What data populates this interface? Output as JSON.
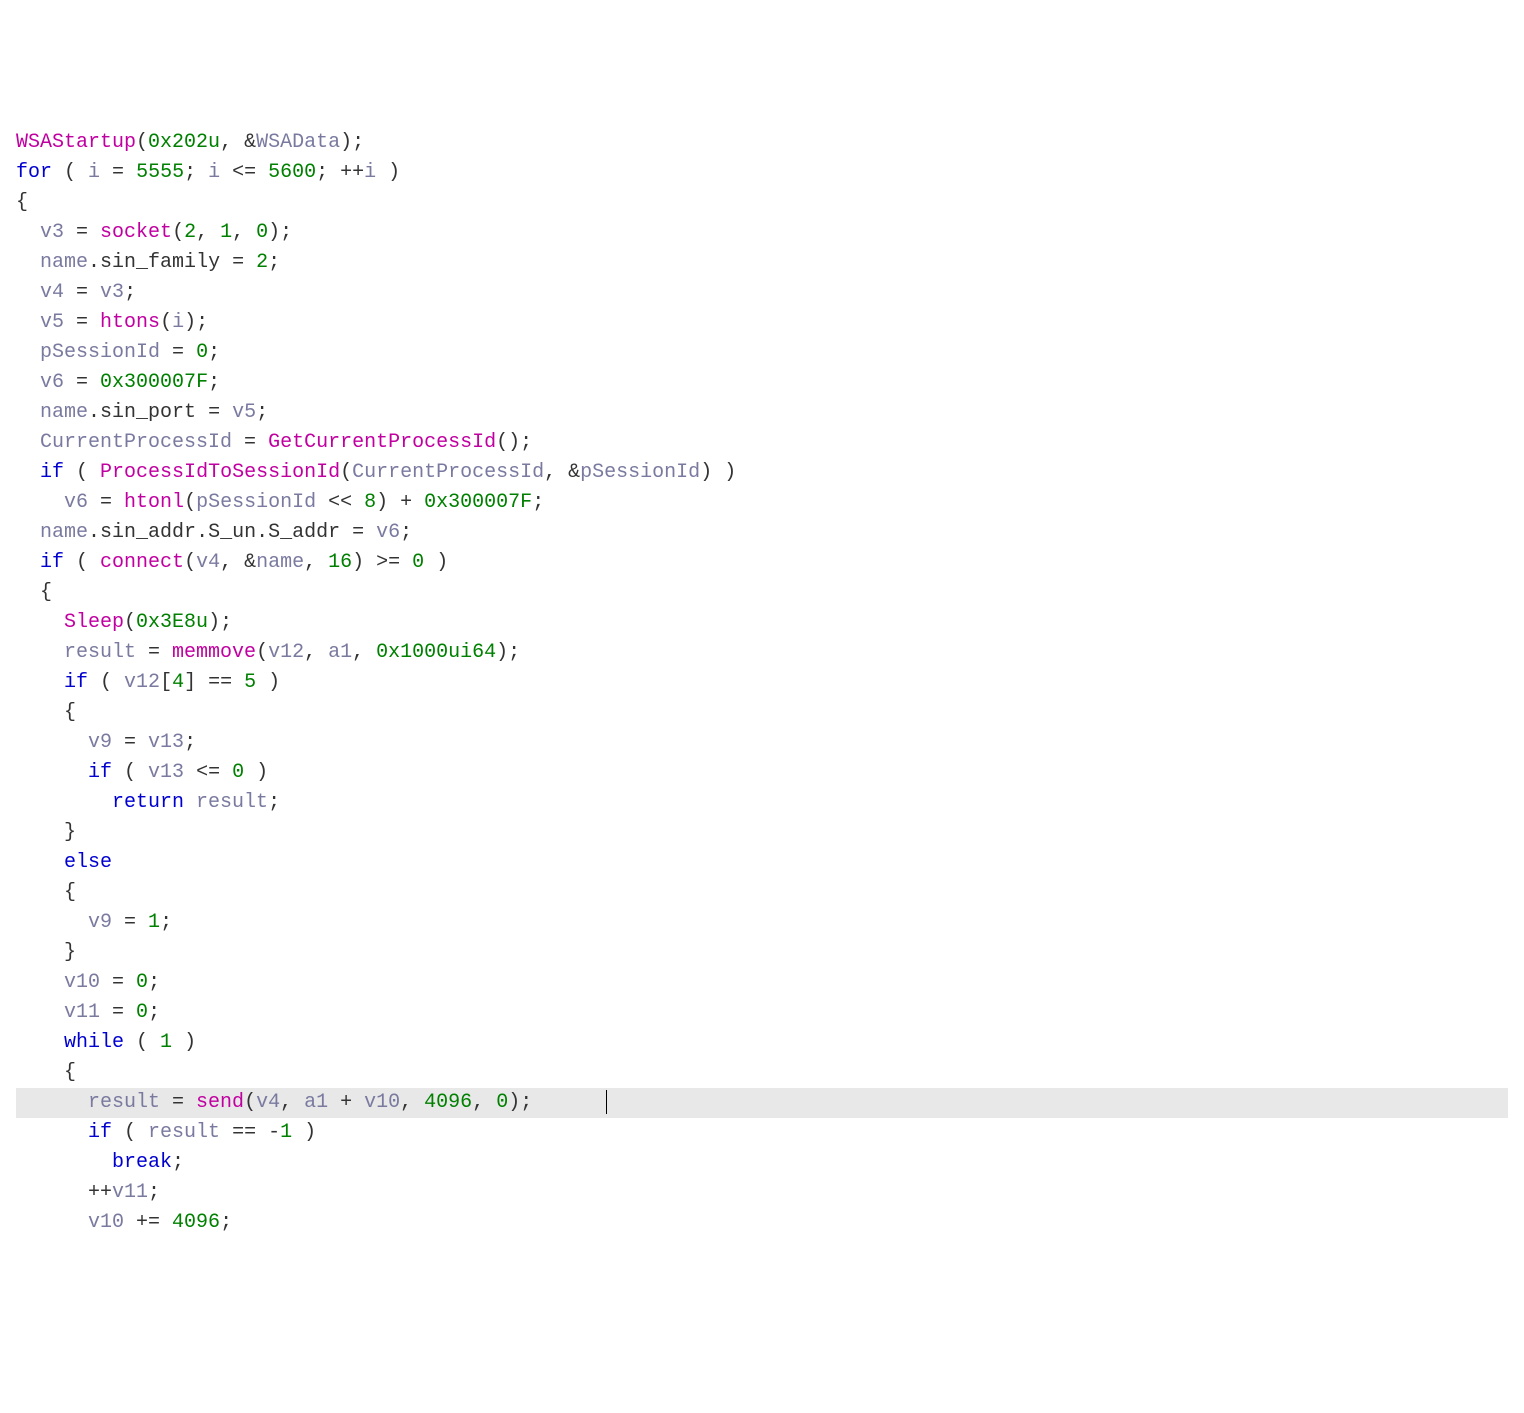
{
  "code": {
    "highlight_line": 31,
    "lines": [
      {
        "indent": 0,
        "tokens": [
          {
            "t": "WSAStartup",
            "c": "fn"
          },
          {
            "t": "(",
            "c": "op"
          },
          {
            "t": "0x202u",
            "c": "num"
          },
          {
            "t": ", &",
            "c": "op"
          },
          {
            "t": "WSAData",
            "c": "var"
          },
          {
            "t": ");",
            "c": "op"
          }
        ]
      },
      {
        "indent": 0,
        "tokens": [
          {
            "t": "for",
            "c": "kw"
          },
          {
            "t": " ( ",
            "c": "op"
          },
          {
            "t": "i",
            "c": "var"
          },
          {
            "t": " = ",
            "c": "op"
          },
          {
            "t": "5555",
            "c": "num"
          },
          {
            "t": "; ",
            "c": "op"
          },
          {
            "t": "i",
            "c": "var"
          },
          {
            "t": " <= ",
            "c": "op"
          },
          {
            "t": "5600",
            "c": "num"
          },
          {
            "t": "; ++",
            "c": "op"
          },
          {
            "t": "i",
            "c": "var"
          },
          {
            "t": " )",
            "c": "op"
          }
        ]
      },
      {
        "indent": 0,
        "tokens": [
          {
            "t": "{",
            "c": "op"
          }
        ]
      },
      {
        "indent": 1,
        "tokens": [
          {
            "t": "v3",
            "c": "var"
          },
          {
            "t": " = ",
            "c": "op"
          },
          {
            "t": "socket",
            "c": "fn"
          },
          {
            "t": "(",
            "c": "op"
          },
          {
            "t": "2",
            "c": "num"
          },
          {
            "t": ", ",
            "c": "op"
          },
          {
            "t": "1",
            "c": "num"
          },
          {
            "t": ", ",
            "c": "op"
          },
          {
            "t": "0",
            "c": "num"
          },
          {
            "t": ");",
            "c": "op"
          }
        ]
      },
      {
        "indent": 1,
        "tokens": [
          {
            "t": "name",
            "c": "var"
          },
          {
            "t": ".",
            "c": "op"
          },
          {
            "t": "sin_family",
            "c": "mem"
          },
          {
            "t": " = ",
            "c": "op"
          },
          {
            "t": "2",
            "c": "num"
          },
          {
            "t": ";",
            "c": "op"
          }
        ]
      },
      {
        "indent": 1,
        "tokens": [
          {
            "t": "v4",
            "c": "var"
          },
          {
            "t": " = ",
            "c": "op"
          },
          {
            "t": "v3",
            "c": "var"
          },
          {
            "t": ";",
            "c": "op"
          }
        ]
      },
      {
        "indent": 1,
        "tokens": [
          {
            "t": "v5",
            "c": "var"
          },
          {
            "t": " = ",
            "c": "op"
          },
          {
            "t": "htons",
            "c": "fn"
          },
          {
            "t": "(",
            "c": "op"
          },
          {
            "t": "i",
            "c": "var"
          },
          {
            "t": ");",
            "c": "op"
          }
        ]
      },
      {
        "indent": 1,
        "tokens": [
          {
            "t": "pSessionId",
            "c": "var"
          },
          {
            "t": " = ",
            "c": "op"
          },
          {
            "t": "0",
            "c": "num"
          },
          {
            "t": ";",
            "c": "op"
          }
        ]
      },
      {
        "indent": 1,
        "tokens": [
          {
            "t": "v6",
            "c": "var"
          },
          {
            "t": " = ",
            "c": "op"
          },
          {
            "t": "0x300007F",
            "c": "num"
          },
          {
            "t": ";",
            "c": "op"
          }
        ]
      },
      {
        "indent": 1,
        "tokens": [
          {
            "t": "name",
            "c": "var"
          },
          {
            "t": ".",
            "c": "op"
          },
          {
            "t": "sin_port",
            "c": "mem"
          },
          {
            "t": " = ",
            "c": "op"
          },
          {
            "t": "v5",
            "c": "var"
          },
          {
            "t": ";",
            "c": "op"
          }
        ]
      },
      {
        "indent": 1,
        "tokens": [
          {
            "t": "CurrentProcessId",
            "c": "var"
          },
          {
            "t": " = ",
            "c": "op"
          },
          {
            "t": "GetCurrentProcessId",
            "c": "fn"
          },
          {
            "t": "();",
            "c": "op"
          }
        ]
      },
      {
        "indent": 1,
        "tokens": [
          {
            "t": "if",
            "c": "kw"
          },
          {
            "t": " ( ",
            "c": "op"
          },
          {
            "t": "ProcessIdToSessionId",
            "c": "fn"
          },
          {
            "t": "(",
            "c": "op"
          },
          {
            "t": "CurrentProcessId",
            "c": "var"
          },
          {
            "t": ", &",
            "c": "op"
          },
          {
            "t": "pSessionId",
            "c": "var"
          },
          {
            "t": ") )",
            "c": "op"
          }
        ]
      },
      {
        "indent": 2,
        "tokens": [
          {
            "t": "v6",
            "c": "var"
          },
          {
            "t": " = ",
            "c": "op"
          },
          {
            "t": "htonl",
            "c": "fn"
          },
          {
            "t": "(",
            "c": "op"
          },
          {
            "t": "pSessionId",
            "c": "var"
          },
          {
            "t": " << ",
            "c": "op"
          },
          {
            "t": "8",
            "c": "num"
          },
          {
            "t": ") + ",
            "c": "op"
          },
          {
            "t": "0x300007F",
            "c": "num"
          },
          {
            "t": ";",
            "c": "op"
          }
        ]
      },
      {
        "indent": 1,
        "tokens": [
          {
            "t": "name",
            "c": "var"
          },
          {
            "t": ".",
            "c": "op"
          },
          {
            "t": "sin_addr",
            "c": "mem"
          },
          {
            "t": ".",
            "c": "op"
          },
          {
            "t": "S_un",
            "c": "mem"
          },
          {
            "t": ".",
            "c": "op"
          },
          {
            "t": "S_addr",
            "c": "mem"
          },
          {
            "t": " = ",
            "c": "op"
          },
          {
            "t": "v6",
            "c": "var"
          },
          {
            "t": ";",
            "c": "op"
          }
        ]
      },
      {
        "indent": 1,
        "tokens": [
          {
            "t": "if",
            "c": "kw"
          },
          {
            "t": " ( ",
            "c": "op"
          },
          {
            "t": "connect",
            "c": "fn"
          },
          {
            "t": "(",
            "c": "op"
          },
          {
            "t": "v4",
            "c": "var"
          },
          {
            "t": ", &",
            "c": "op"
          },
          {
            "t": "name",
            "c": "var"
          },
          {
            "t": ", ",
            "c": "op"
          },
          {
            "t": "16",
            "c": "num"
          },
          {
            "t": ") >= ",
            "c": "op"
          },
          {
            "t": "0",
            "c": "num"
          },
          {
            "t": " )",
            "c": "op"
          }
        ]
      },
      {
        "indent": 1,
        "tokens": [
          {
            "t": "{",
            "c": "op"
          }
        ]
      },
      {
        "indent": 2,
        "tokens": [
          {
            "t": "Sleep",
            "c": "fn"
          },
          {
            "t": "(",
            "c": "op"
          },
          {
            "t": "0x3E8u",
            "c": "num"
          },
          {
            "t": ");",
            "c": "op"
          }
        ]
      },
      {
        "indent": 2,
        "tokens": [
          {
            "t": "result",
            "c": "var"
          },
          {
            "t": " = ",
            "c": "op"
          },
          {
            "t": "memmove",
            "c": "fn"
          },
          {
            "t": "(",
            "c": "op"
          },
          {
            "t": "v12",
            "c": "var"
          },
          {
            "t": ", ",
            "c": "op"
          },
          {
            "t": "a1",
            "c": "var"
          },
          {
            "t": ", ",
            "c": "op"
          },
          {
            "t": "0x1000ui64",
            "c": "num"
          },
          {
            "t": ");",
            "c": "op"
          }
        ]
      },
      {
        "indent": 2,
        "tokens": [
          {
            "t": "if",
            "c": "kw"
          },
          {
            "t": " ( ",
            "c": "op"
          },
          {
            "t": "v12",
            "c": "var"
          },
          {
            "t": "[",
            "c": "op"
          },
          {
            "t": "4",
            "c": "num"
          },
          {
            "t": "] == ",
            "c": "op"
          },
          {
            "t": "5",
            "c": "num"
          },
          {
            "t": " )",
            "c": "op"
          }
        ]
      },
      {
        "indent": 2,
        "tokens": [
          {
            "t": "{",
            "c": "op"
          }
        ]
      },
      {
        "indent": 3,
        "tokens": [
          {
            "t": "v9",
            "c": "var"
          },
          {
            "t": " = ",
            "c": "op"
          },
          {
            "t": "v13",
            "c": "var"
          },
          {
            "t": ";",
            "c": "op"
          }
        ]
      },
      {
        "indent": 3,
        "tokens": [
          {
            "t": "if",
            "c": "kw"
          },
          {
            "t": " ( ",
            "c": "op"
          },
          {
            "t": "v13",
            "c": "var"
          },
          {
            "t": " <= ",
            "c": "op"
          },
          {
            "t": "0",
            "c": "num"
          },
          {
            "t": " )",
            "c": "op"
          }
        ]
      },
      {
        "indent": 4,
        "tokens": [
          {
            "t": "return",
            "c": "kw"
          },
          {
            "t": " ",
            "c": "op"
          },
          {
            "t": "result",
            "c": "var"
          },
          {
            "t": ";",
            "c": "op"
          }
        ]
      },
      {
        "indent": 2,
        "tokens": [
          {
            "t": "}",
            "c": "op"
          }
        ]
      },
      {
        "indent": 2,
        "tokens": [
          {
            "t": "else",
            "c": "kw"
          }
        ]
      },
      {
        "indent": 2,
        "tokens": [
          {
            "t": "{",
            "c": "op"
          }
        ]
      },
      {
        "indent": 3,
        "tokens": [
          {
            "t": "v9",
            "c": "var"
          },
          {
            "t": " = ",
            "c": "op"
          },
          {
            "t": "1",
            "c": "num"
          },
          {
            "t": ";",
            "c": "op"
          }
        ]
      },
      {
        "indent": 2,
        "tokens": [
          {
            "t": "}",
            "c": "op"
          }
        ]
      },
      {
        "indent": 2,
        "tokens": [
          {
            "t": "v10",
            "c": "var"
          },
          {
            "t": " = ",
            "c": "op"
          },
          {
            "t": "0",
            "c": "num"
          },
          {
            "t": ";",
            "c": "op"
          }
        ]
      },
      {
        "indent": 2,
        "tokens": [
          {
            "t": "v11",
            "c": "var"
          },
          {
            "t": " = ",
            "c": "op"
          },
          {
            "t": "0",
            "c": "num"
          },
          {
            "t": ";",
            "c": "op"
          }
        ]
      },
      {
        "indent": 2,
        "tokens": [
          {
            "t": "while",
            "c": "kw"
          },
          {
            "t": " ( ",
            "c": "op"
          },
          {
            "t": "1",
            "c": "num"
          },
          {
            "t": " )",
            "c": "op"
          }
        ]
      },
      {
        "indent": 2,
        "tokens": [
          {
            "t": "{",
            "c": "op"
          }
        ]
      },
      {
        "indent": 3,
        "caret": true,
        "tokens": [
          {
            "t": "result",
            "c": "var"
          },
          {
            "t": " = ",
            "c": "op"
          },
          {
            "t": "send",
            "c": "fn"
          },
          {
            "t": "(",
            "c": "op"
          },
          {
            "t": "v4",
            "c": "var"
          },
          {
            "t": ", ",
            "c": "op"
          },
          {
            "t": "a1",
            "c": "var"
          },
          {
            "t": " + ",
            "c": "op"
          },
          {
            "t": "v10",
            "c": "var"
          },
          {
            "t": ", ",
            "c": "op"
          },
          {
            "t": "4096",
            "c": "num"
          },
          {
            "t": ", ",
            "c": "op"
          },
          {
            "t": "0",
            "c": "num"
          },
          {
            "t": ");",
            "c": "op"
          }
        ]
      },
      {
        "indent": 3,
        "tokens": [
          {
            "t": "if",
            "c": "kw"
          },
          {
            "t": " ( ",
            "c": "op"
          },
          {
            "t": "result",
            "c": "var"
          },
          {
            "t": " == -",
            "c": "op"
          },
          {
            "t": "1",
            "c": "num"
          },
          {
            "t": " )",
            "c": "op"
          }
        ]
      },
      {
        "indent": 4,
        "tokens": [
          {
            "t": "break",
            "c": "kw"
          },
          {
            "t": ";",
            "c": "op"
          }
        ]
      },
      {
        "indent": 3,
        "tokens": [
          {
            "t": "++",
            "c": "op"
          },
          {
            "t": "v11",
            "c": "var"
          },
          {
            "t": ";",
            "c": "op"
          }
        ]
      },
      {
        "indent": 3,
        "tokens": [
          {
            "t": "v10",
            "c": "var"
          },
          {
            "t": " += ",
            "c": "op"
          },
          {
            "t": "4096",
            "c": "num"
          },
          {
            "t": ";",
            "c": "op"
          }
        ]
      }
    ]
  }
}
